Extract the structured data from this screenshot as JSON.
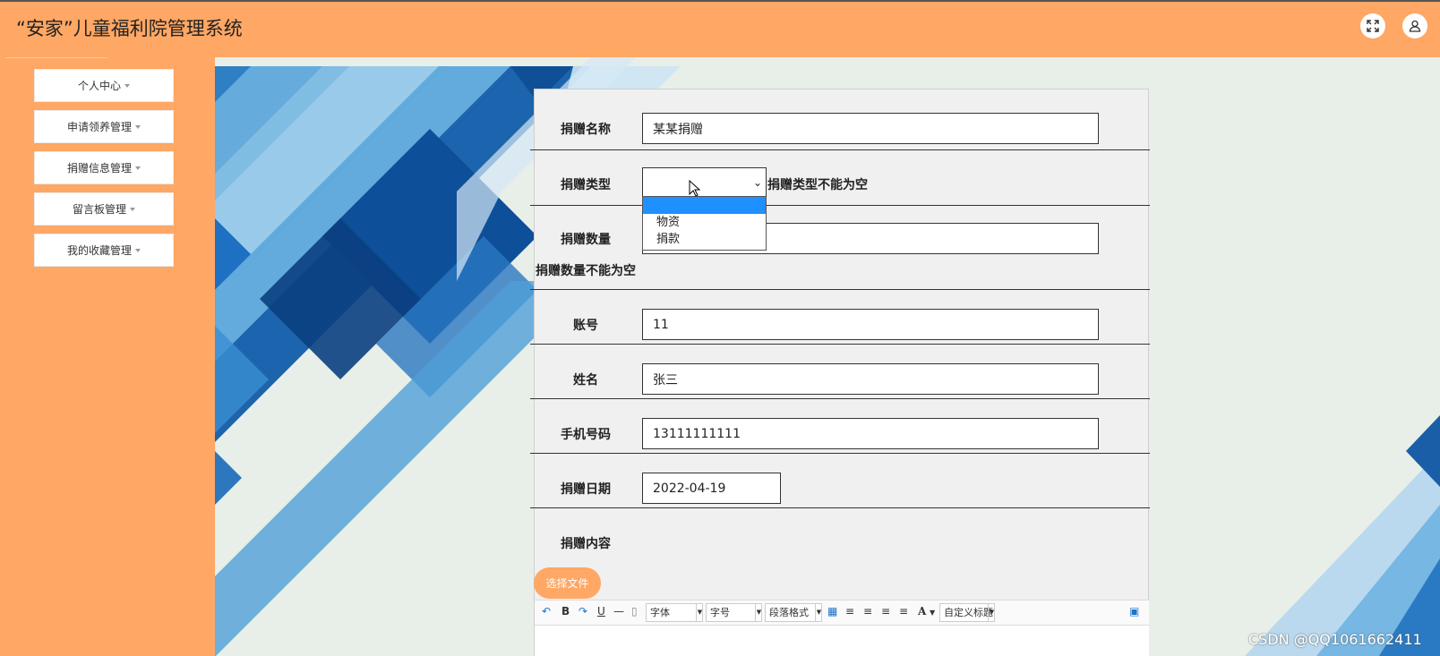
{
  "header": {
    "title": "“安家”儿童福利院管理系统",
    "fullscreen_icon": "⤢",
    "user_icon": "person-icon"
  },
  "sidebar": {
    "items": [
      {
        "label": "个人中心"
      },
      {
        "label": "申请领养管理"
      },
      {
        "label": "捐赠信息管理"
      },
      {
        "label": "留言板管理"
      },
      {
        "label": "我的收藏管理"
      }
    ]
  },
  "form": {
    "donation_name": {
      "label": "捐赠名称",
      "value": "某某捐赠"
    },
    "donation_type": {
      "label": "捐赠类型",
      "value": "",
      "options": [
        "",
        "物资",
        "捐款"
      ],
      "error": "捐赠类型不能为空"
    },
    "donation_quantity": {
      "label": "捐赠数量",
      "value": "",
      "error": "捐赠数量不能为空"
    },
    "account": {
      "label": "账号",
      "value": "11"
    },
    "name": {
      "label": "姓名",
      "value": "张三"
    },
    "phone": {
      "label": "手机号码",
      "value": "13111111111"
    },
    "donation_date": {
      "label": "捐赠日期",
      "value": "2022-04-19"
    },
    "donation_content": {
      "label": "捐赠内容"
    },
    "file_button": "选择文件"
  },
  "editor_toolbar": {
    "bold": "B",
    "underline": "U",
    "font_family": "字体",
    "font_size": "字号",
    "paragraph_format": "段落格式",
    "font_color": "A",
    "custom_title": "自定义标题"
  },
  "watermark": "CSDN @QQ1061662411",
  "colors": {
    "accent": "#ffa764",
    "selected_option": "#1e90ff"
  }
}
